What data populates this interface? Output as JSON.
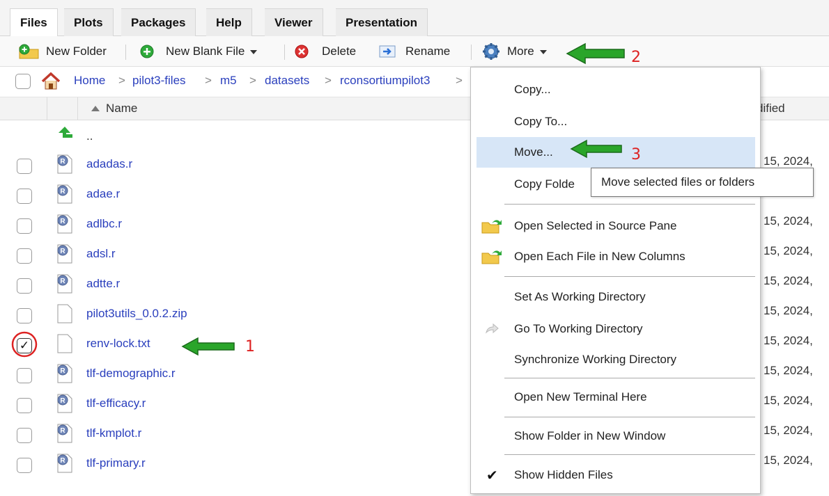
{
  "tabs": [
    {
      "label": "Files",
      "active": true
    },
    {
      "label": "Plots"
    },
    {
      "label": "Packages"
    },
    {
      "label": "Help"
    },
    {
      "label": "Viewer"
    },
    {
      "label": "Presentation"
    }
  ],
  "toolbar": {
    "new_folder": "New Folder",
    "new_blank_file": "New Blank File",
    "delete": "Delete",
    "rename": "Rename",
    "more": "More"
  },
  "breadcrumb": [
    "Home",
    "pilot3-files",
    "m5",
    "datasets",
    "rconsortiumpilot3"
  ],
  "columns": {
    "name": "Name",
    "modified": "dified",
    "sort_icon": "triangle-up-icon"
  },
  "parent_dir": "..",
  "files": [
    {
      "name": "adadas.r",
      "type": "r",
      "date": "15, 2024,",
      "checked": false
    },
    {
      "name": "adae.r",
      "type": "r",
      "date": "15, 2024,",
      "checked": false
    },
    {
      "name": "adlbc.r",
      "type": "r",
      "date": "15, 2024,",
      "checked": false
    },
    {
      "name": "adsl.r",
      "type": "r",
      "date": "15, 2024,",
      "checked": false
    },
    {
      "name": "adtte.r",
      "type": "r",
      "date": "15, 2024,",
      "checked": false
    },
    {
      "name": "pilot3utils_0.0.2.zip",
      "type": "file",
      "date": "15, 2024,",
      "checked": false
    },
    {
      "name": "renv-lock.txt",
      "type": "file",
      "date": "15, 2024,",
      "checked": true
    },
    {
      "name": "tlf-demographic.r",
      "type": "r",
      "date": "15, 2024,",
      "checked": false
    },
    {
      "name": "tlf-efficacy.r",
      "type": "r",
      "date": "15, 2024,",
      "checked": false
    },
    {
      "name": "tlf-kmplot.r",
      "type": "r",
      "date": "15, 2024,",
      "checked": false
    },
    {
      "name": "tlf-primary.r",
      "type": "r",
      "date": "15, 2024,",
      "checked": false
    }
  ],
  "menu": {
    "items": [
      "Copy...",
      "Copy To...",
      "Move...",
      "Copy Folde",
      "Open Selected in Source Pane",
      "Open Each File in New Columns",
      "Set As Working Directory",
      "Go To Working Directory",
      "Synchronize Working Directory",
      "Open New Terminal Here",
      "Show Folder in New Window",
      "Show Hidden Files"
    ],
    "highlighted": "Move...",
    "checkmark": "✔"
  },
  "tooltip": "Move selected files or folders",
  "annotations": {
    "a1": "1",
    "a2": "2",
    "a3": "3"
  },
  "colors": {
    "link": "#2a3fbd",
    "highlight": "#d7e6f7",
    "arrow": "#2aa52a",
    "annotation": "#dd2222"
  }
}
